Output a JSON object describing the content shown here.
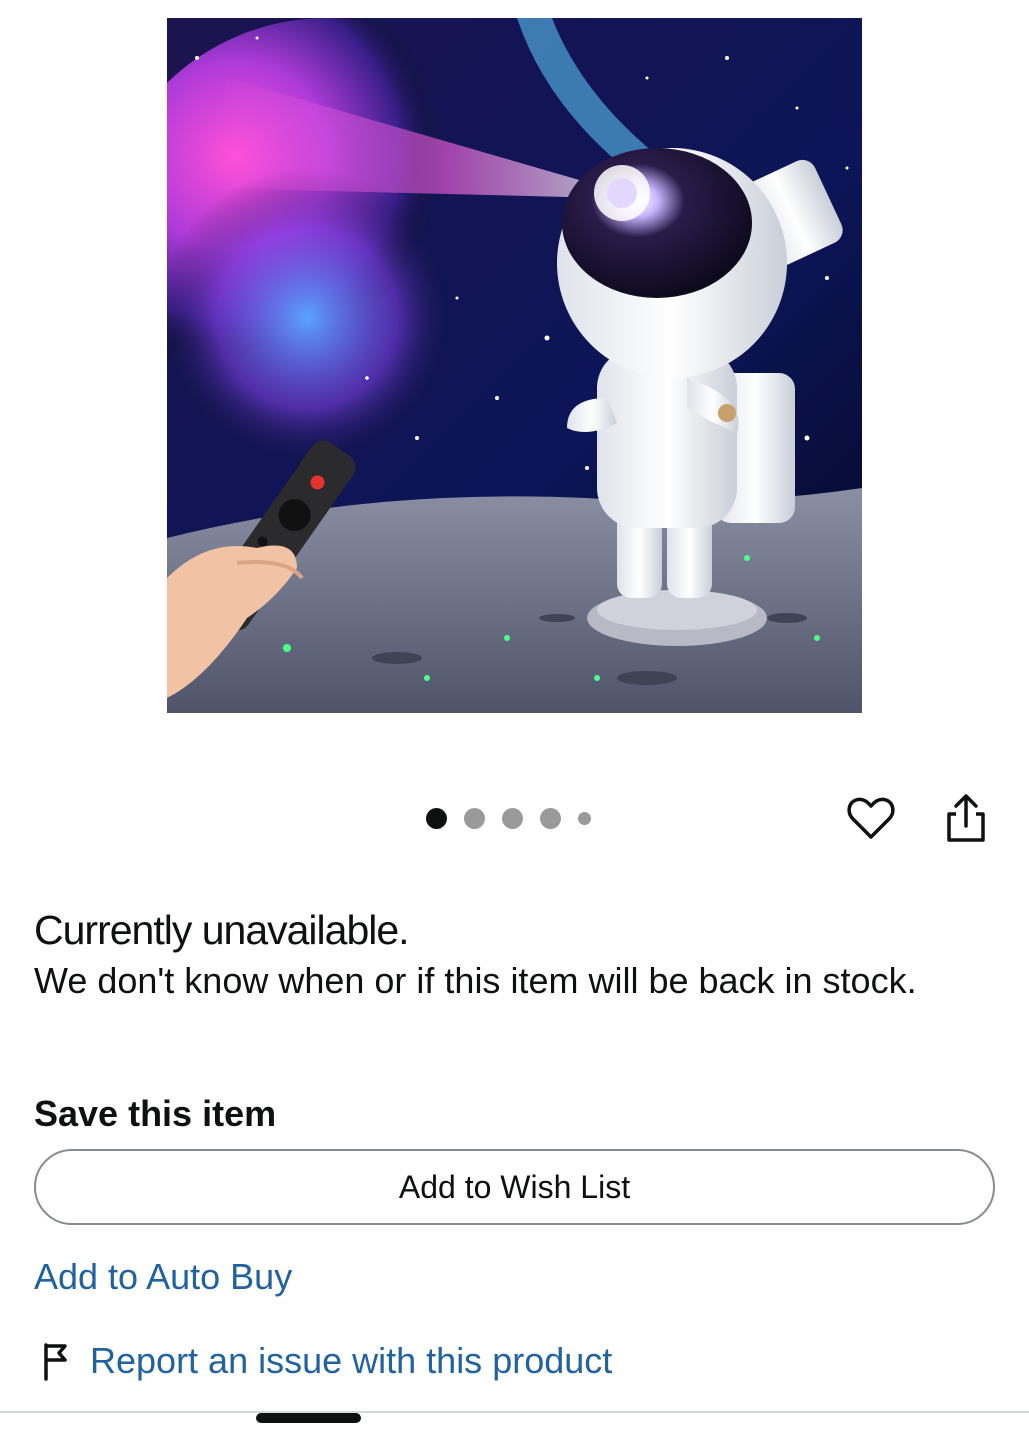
{
  "product": {
    "image_alt": "Astronaut galaxy star projector with remote control"
  },
  "carousel": {
    "total": 5,
    "active": 1
  },
  "actions": {
    "wishlist_icon": "heart-icon",
    "share_icon": "share-icon"
  },
  "availability": {
    "title": "Currently unavailable.",
    "description": "We don't know when or if this item will be back in stock."
  },
  "save_section": {
    "heading": "Save this item",
    "wishlist_button": "Add to Wish List",
    "auto_buy_link": "Add to Auto Buy"
  },
  "report": {
    "icon": "flag-icon",
    "label": "Report an issue with this product"
  },
  "colors": {
    "link": "#2162a1",
    "text": "#0f1111",
    "border": "#888c8c"
  }
}
